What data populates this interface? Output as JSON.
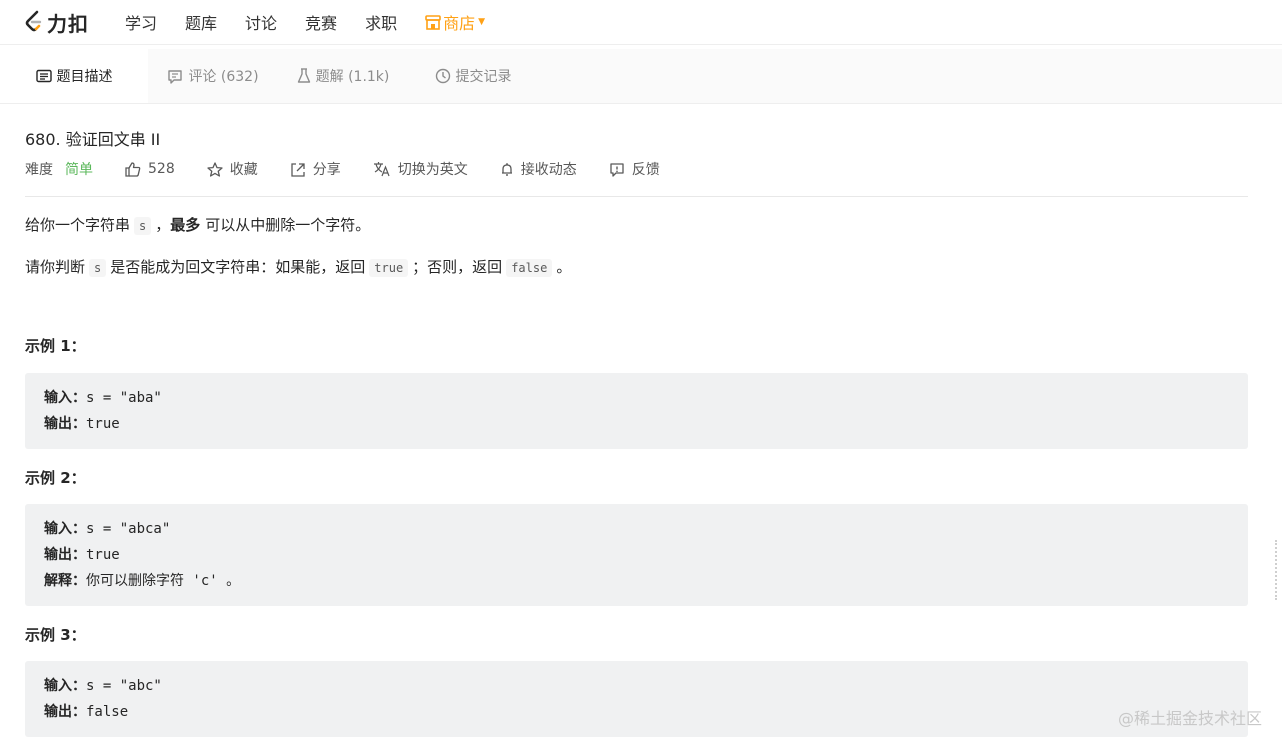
{
  "nav": {
    "logo_text": "力扣",
    "items": [
      "学习",
      "题库",
      "讨论",
      "竞赛",
      "求职"
    ],
    "store_label": "商店",
    "accent_color": "#ffa116"
  },
  "tabs": [
    {
      "label": "题目描述",
      "icon": "description-icon",
      "active": true
    },
    {
      "label": "评论 (632)",
      "icon": "comment-icon",
      "active": false
    },
    {
      "label": "题解 (1.1k)",
      "icon": "flask-icon",
      "active": false
    },
    {
      "label": "提交记录",
      "icon": "clock-icon",
      "active": false
    }
  ],
  "problem": {
    "title": "680. 验证回文串 II",
    "difficulty_label": "难度",
    "difficulty": "简单",
    "difficulty_color": "#5cb85c",
    "likes": "528",
    "favorite_label": "收藏",
    "share_label": "分享",
    "switch_lang_label": "切换为英文",
    "subscribe_label": "接收动态",
    "feedback_label": "反馈"
  },
  "description": {
    "p1_a": "给你一个字符串",
    "p1_code": "s",
    "p1_b": "，",
    "p1_bold": "最多",
    "p1_c": "可以从中删除一个字符。",
    "p2_a": "请你判断",
    "p2_code1": "s",
    "p2_b": "是否能成为回文字符串：如果能，返回",
    "p2_code2": "true",
    "p2_c": "；否则，返回",
    "p2_code3": "false",
    "p2_d": "。"
  },
  "examples": [
    {
      "title": "示例 1：",
      "lines": [
        {
          "label": "输入：",
          "text": "s = \"aba\""
        },
        {
          "label": "输出：",
          "text": "true"
        }
      ]
    },
    {
      "title": "示例 2：",
      "lines": [
        {
          "label": "输入：",
          "text": "s = \"abca\""
        },
        {
          "label": "输出：",
          "text": "true"
        },
        {
          "label": "解释：",
          "text": "你可以删除字符 'c' 。"
        }
      ]
    },
    {
      "title": "示例 3：",
      "lines": [
        {
          "label": "输入：",
          "text": "s = \"abc\""
        },
        {
          "label": "输出：",
          "text": "false"
        }
      ]
    }
  ],
  "watermark": "@稀土掘金技术社区"
}
